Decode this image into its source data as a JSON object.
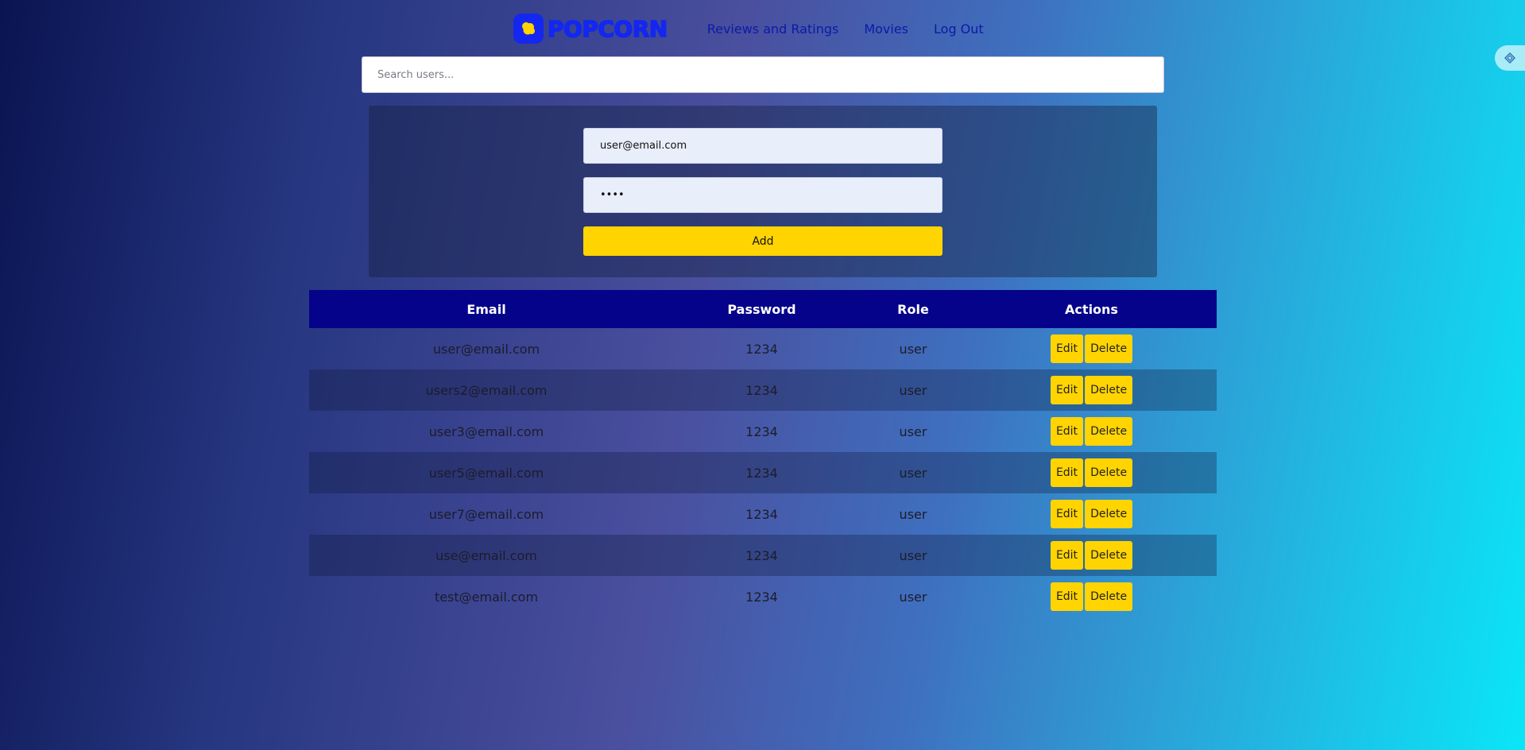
{
  "header": {
    "logo_text": "POPCORN",
    "nav": [
      {
        "label": "Reviews and Ratings"
      },
      {
        "label": "Movies"
      },
      {
        "label": "Log Out"
      }
    ]
  },
  "search": {
    "placeholder": "Search users..."
  },
  "form": {
    "email_value": "user@email.com",
    "password_value": "1234",
    "add_label": "Add"
  },
  "table": {
    "headers": [
      "Email",
      "Password",
      "Role",
      "Actions"
    ],
    "edit_label": "Edit",
    "delete_label": "Delete",
    "rows": [
      {
        "email": "user@email.com",
        "password": "1234",
        "role": "user"
      },
      {
        "email": "users2@email.com",
        "password": "1234",
        "role": "user"
      },
      {
        "email": "user3@email.com",
        "password": "1234",
        "role": "user"
      },
      {
        "email": "user5@email.com",
        "password": "1234",
        "role": "user"
      },
      {
        "email": "user7@email.com",
        "password": "1234",
        "role": "user"
      },
      {
        "email": "use@email.com",
        "password": "1234",
        "role": "user"
      },
      {
        "email": "test@email.com",
        "password": "1234",
        "role": "user"
      }
    ]
  },
  "colors": {
    "accent": "#ffd400",
    "brand": "#1327f0",
    "table_header": "#05038a"
  },
  "icons": {
    "logo": "popcorn-icon",
    "side_widget": "extension-icon"
  }
}
